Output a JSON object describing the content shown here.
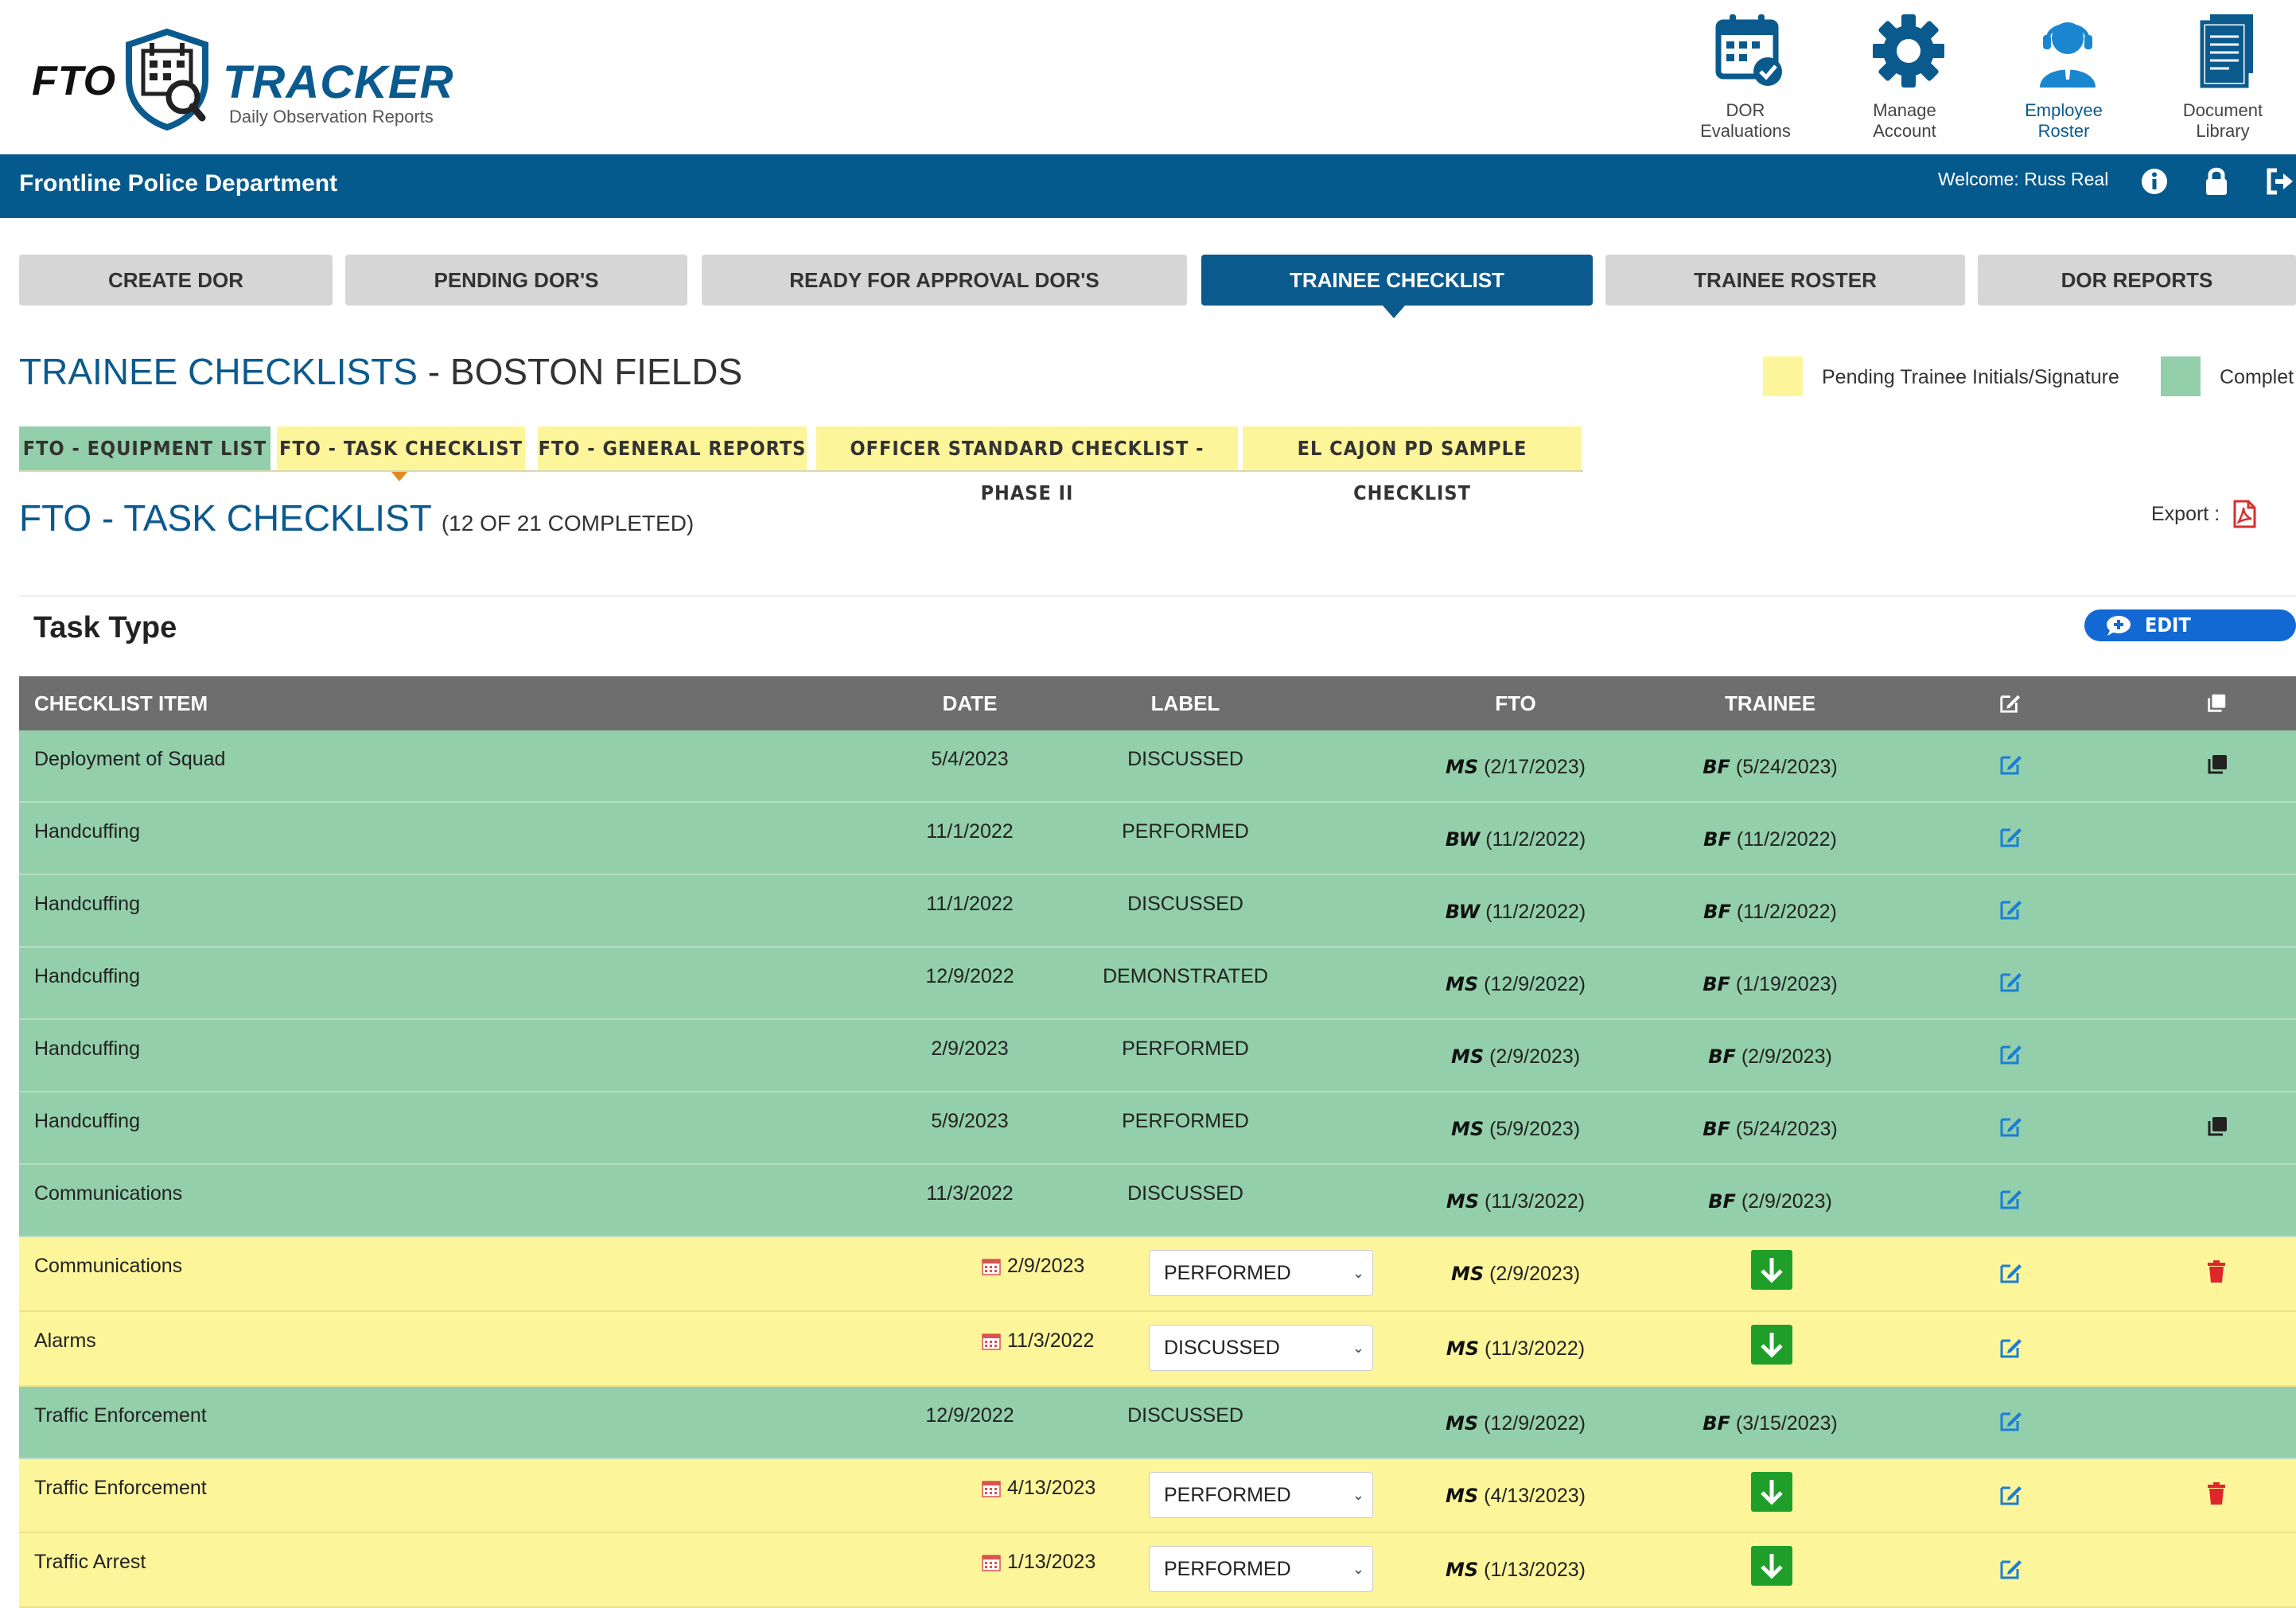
{
  "app": {
    "logo_left": "FTO",
    "logo_right": "TRACKER",
    "logo_subtitle": "Daily Observation Reports"
  },
  "top_nav": [
    {
      "label": "DOR Evaluations",
      "icon": "calendar-check-icon"
    },
    {
      "label": "Manage Account",
      "icon": "gear-icon"
    },
    {
      "label": "Employee Roster",
      "icon": "support-agent-icon"
    },
    {
      "label": "Document Library",
      "icon": "documents-icon"
    }
  ],
  "header_bar": {
    "department": "Frontline Police Department",
    "welcome": "Welcome: Russ Real",
    "icons": [
      "info-icon",
      "lock-icon",
      "logout-icon"
    ]
  },
  "main_tabs": [
    {
      "label": "CREATE DOR",
      "active": false
    },
    {
      "label": "PENDING DOR'S",
      "active": false
    },
    {
      "label": "READY FOR APPROVAL DOR'S",
      "active": false
    },
    {
      "label": "TRAINEE CHECKLIST",
      "active": true
    },
    {
      "label": "TRAINEE ROSTER",
      "active": false
    },
    {
      "label": "DOR REPORTS",
      "active": false
    }
  ],
  "page": {
    "title_main": "TRAINEE CHECKLISTS",
    "title_sep": " - ",
    "title_name": "BOSTON FIELDS"
  },
  "legend": [
    {
      "label": "Pending Trainee Initials/Signature",
      "color": "#fdf59a"
    },
    {
      "label": "Complet",
      "color": "#93cfaa"
    }
  ],
  "sub_tabs": [
    {
      "label": "FTO - EQUIPMENT LIST",
      "color": "#93cfaa"
    },
    {
      "label": "FTO - TASK CHECKLIST",
      "color": "#fdf59a",
      "active": true
    },
    {
      "label": "FTO - GENERAL REPORTS",
      "color": "#fdf59a"
    },
    {
      "label": "OFFICER STANDARD CHECKLIST - PHASE II",
      "color": "#fdf59a"
    },
    {
      "label": "EL CAJON PD SAMPLE CHECKLIST",
      "color": "#fdf59a"
    }
  ],
  "section": {
    "title": "FTO - TASK CHECKLIST",
    "count": "(12 OF 21 COMPLETED)",
    "export_label": "Export :",
    "task_type": "Task Type",
    "edit_comment": "EDIT COMMENT"
  },
  "table": {
    "columns": [
      "CHECKLIST ITEM",
      "DATE",
      "LABEL",
      "FTO",
      "TRAINEE"
    ],
    "rows": [
      {
        "item": "Deployment of Squad",
        "date": "5/4/2023",
        "label": "DISCUSSED",
        "fto_init": "MS",
        "fto_date": "(2/17/2023)",
        "trn_init": "BF",
        "trn_date": "(5/24/2023)",
        "status": "complete",
        "copy": true,
        "trash": false
      },
      {
        "item": "Handcuffing",
        "date": "11/1/2022",
        "label": "PERFORMED",
        "fto_init": "BW",
        "fto_date": "(11/2/2022)",
        "trn_init": "BF",
        "trn_date": "(11/2/2022)",
        "status": "complete",
        "copy": false,
        "trash": false
      },
      {
        "item": "Handcuffing",
        "date": "11/1/2022",
        "label": "DISCUSSED",
        "fto_init": "BW",
        "fto_date": "(11/2/2022)",
        "trn_init": "BF",
        "trn_date": "(11/2/2022)",
        "status": "complete",
        "copy": false,
        "trash": false
      },
      {
        "item": "Handcuffing",
        "date": "12/9/2022",
        "label": "DEMONSTRATED",
        "fto_init": "MS",
        "fto_date": "(12/9/2022)",
        "trn_init": "BF",
        "trn_date": "(1/19/2023)",
        "status": "complete",
        "copy": false,
        "trash": false
      },
      {
        "item": "Handcuffing",
        "date": "2/9/2023",
        "label": "PERFORMED",
        "fto_init": "MS",
        "fto_date": "(2/9/2023)",
        "trn_init": "BF",
        "trn_date": "(2/9/2023)",
        "status": "complete",
        "copy": false,
        "trash": false
      },
      {
        "item": "Handcuffing",
        "date": "5/9/2023",
        "label": "PERFORMED",
        "fto_init": "MS",
        "fto_date": "(5/9/2023)",
        "trn_init": "BF",
        "trn_date": "(5/24/2023)",
        "status": "complete",
        "copy": true,
        "trash": false
      },
      {
        "item": "Communications",
        "date": "11/3/2022",
        "label": "DISCUSSED",
        "fto_init": "MS",
        "fto_date": "(11/3/2022)",
        "trn_init": "BF",
        "trn_date": "(2/9/2023)",
        "status": "complete",
        "copy": false,
        "trash": false
      },
      {
        "item": "Communications",
        "date": "2/9/2023",
        "label": "PERFORMED",
        "fto_init": "MS",
        "fto_date": "(2/9/2023)",
        "trn_init": "",
        "trn_date": "",
        "status": "pending",
        "copy": false,
        "trash": true
      },
      {
        "item": "Alarms",
        "date": "11/3/2022",
        "label": "DISCUSSED",
        "fto_init": "MS",
        "fto_date": "(11/3/2022)",
        "trn_init": "",
        "trn_date": "",
        "status": "pending",
        "copy": false,
        "trash": false
      },
      {
        "item": "Traffic Enforcement",
        "date": "12/9/2022",
        "label": "DISCUSSED",
        "fto_init": "MS",
        "fto_date": "(12/9/2022)",
        "trn_init": "BF",
        "trn_date": "(3/15/2023)",
        "status": "complete",
        "copy": false,
        "trash": false
      },
      {
        "item": "Traffic Enforcement",
        "date": "4/13/2023",
        "label": "PERFORMED",
        "fto_init": "MS",
        "fto_date": "(4/13/2023)",
        "trn_init": "",
        "trn_date": "",
        "status": "pending",
        "copy": false,
        "trash": true
      },
      {
        "item": "Traffic Arrest",
        "date": "1/13/2023",
        "label": "PERFORMED",
        "fto_init": "MS",
        "fto_date": "(1/13/2023)",
        "trn_init": "",
        "trn_date": "",
        "status": "pending",
        "copy": false,
        "trash": false
      }
    ]
  },
  "colors": {
    "brand_blue": "#0b5a8e",
    "complete_green": "#93cfaa",
    "pending_yellow": "#fdf59a",
    "action_blue": "#1269d3",
    "download_green": "#1f9f2a",
    "trash_red": "#e0262d"
  }
}
